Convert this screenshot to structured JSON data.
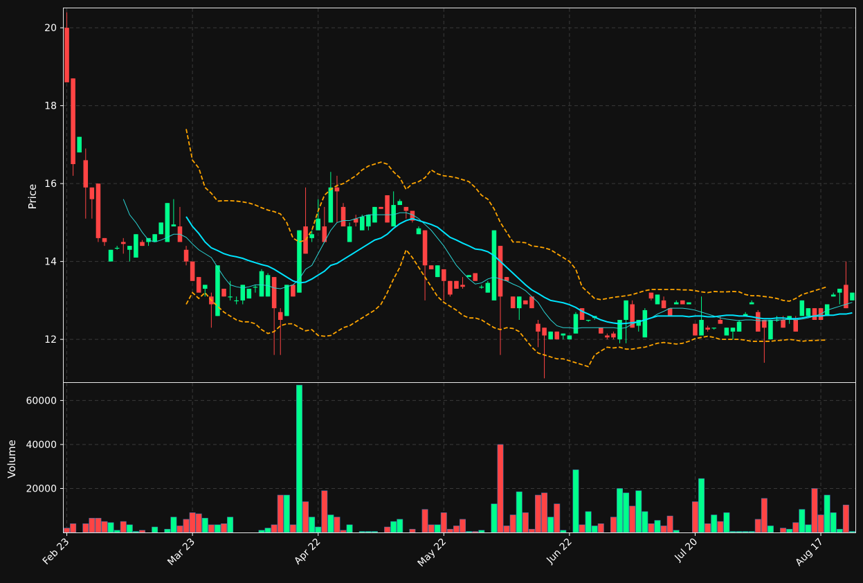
{
  "chart_data": {
    "type": "candlestick",
    "price_panel": {
      "ylabel": "Price",
      "ylim": [
        10.9,
        20.5
      ],
      "yticks": [
        12,
        14,
        16,
        18,
        20
      ],
      "grid": true
    },
    "volume_panel": {
      "ylabel": "Volume",
      "ylim": [
        0,
        68000
      ],
      "yticks": [
        20000,
        40000,
        60000
      ],
      "grid": true
    },
    "x_tick_labels": [
      {
        "label": "Feb 23",
        "index": 0
      },
      {
        "label": "Mar 23",
        "index": 20
      },
      {
        "label": "Apr 22",
        "index": 40
      },
      {
        "label": "May 22",
        "index": 60
      },
      {
        "label": "Jun 22",
        "index": 80
      },
      {
        "label": "Jul 20",
        "index": 100
      },
      {
        "label": "Aug 17",
        "index": 120
      }
    ],
    "colors": {
      "background": "#111111",
      "up": "#00ff8c",
      "down": "#ff4444",
      "volume_edge": "#3b6ea5",
      "ma_fast": "#2ad4d4",
      "ma_slow": "#00e5ff",
      "bands": "#ffa500"
    },
    "candles": [
      [
        20.0,
        20.4,
        18.6,
        18.6
      ],
      [
        18.7,
        18.7,
        16.2,
        16.5
      ],
      [
        16.8,
        17.2,
        16.8,
        17.2
      ],
      [
        16.6,
        16.9,
        15.1,
        15.9
      ],
      [
        15.9,
        15.9,
        15.1,
        15.6
      ],
      [
        16.0,
        16.0,
        14.5,
        14.6
      ],
      [
        14.6,
        14.6,
        14.4,
        14.5
      ],
      [
        14.0,
        14.3,
        14.0,
        14.3
      ],
      [
        14.35,
        14.4,
        14.3,
        14.35
      ],
      [
        14.5,
        14.6,
        14.2,
        14.45
      ],
      [
        14.3,
        14.4,
        14.0,
        14.4
      ],
      [
        14.1,
        14.7,
        14.1,
        14.7
      ],
      [
        14.5,
        14.55,
        14.4,
        14.4
      ],
      [
        14.5,
        14.6,
        14.4,
        14.6
      ],
      [
        14.5,
        14.7,
        14.5,
        14.7
      ],
      [
        14.7,
        15.0,
        14.7,
        15.0
      ],
      [
        14.5,
        15.5,
        14.5,
        15.5
      ],
      [
        14.9,
        15.6,
        14.9,
        14.95
      ],
      [
        14.9,
        15.4,
        14.5,
        14.5
      ],
      [
        14.3,
        14.4,
        13.9,
        14.0
      ],
      [
        14.0,
        14.0,
        13.5,
        13.5
      ],
      [
        13.6,
        13.6,
        13.2,
        13.2
      ],
      [
        13.3,
        13.4,
        13.1,
        13.4
      ],
      [
        13.1,
        13.2,
        12.3,
        12.9
      ],
      [
        12.6,
        13.9,
        12.6,
        13.9
      ],
      [
        13.3,
        13.3,
        13.1,
        13.1
      ],
      [
        13.1,
        13.5,
        13.0,
        13.1
      ],
      [
        13.0,
        13.1,
        12.9,
        13.0
      ],
      [
        13.0,
        13.4,
        12.9,
        13.4
      ],
      [
        13.05,
        13.3,
        13.05,
        13.3
      ],
      [
        13.35,
        13.4,
        13.2,
        13.35
      ],
      [
        13.1,
        13.8,
        13.1,
        13.75
      ],
      [
        13.1,
        13.7,
        13.1,
        13.65
      ],
      [
        13.6,
        13.6,
        11.6,
        12.8
      ],
      [
        12.7,
        12.8,
        11.6,
        12.5
      ],
      [
        12.6,
        13.4,
        12.6,
        13.4
      ],
      [
        13.4,
        13.4,
        13.1,
        13.1
      ],
      [
        13.2,
        14.8,
        13.2,
        14.8
      ],
      [
        14.9,
        15.9,
        14.2,
        14.2
      ],
      [
        14.6,
        14.8,
        14.5,
        14.7
      ],
      [
        14.8,
        15.6,
        14.8,
        15.1
      ],
      [
        14.9,
        15.4,
        14.5,
        14.5
      ],
      [
        15.0,
        16.3,
        15.0,
        15.9
      ],
      [
        15.9,
        16.2,
        15.0,
        15.8
      ],
      [
        15.4,
        15.5,
        14.9,
        14.9
      ],
      [
        14.5,
        15.0,
        14.5,
        14.9
      ],
      [
        15.1,
        15.2,
        14.9,
        15.0
      ],
      [
        14.8,
        15.2,
        14.8,
        15.15
      ],
      [
        14.9,
        15.2,
        14.8,
        15.2
      ],
      [
        15.0,
        15.4,
        15.0,
        15.4
      ],
      [
        15.4,
        15.4,
        15.35,
        15.35
      ],
      [
        15.7,
        15.7,
        15.0,
        15.0
      ],
      [
        14.9,
        15.8,
        14.9,
        15.45
      ],
      [
        15.45,
        15.6,
        15.45,
        15.55
      ],
      [
        15.4,
        15.4,
        15.1,
        15.3
      ],
      [
        15.3,
        15.3,
        15.0,
        15.05
      ],
      [
        14.7,
        14.9,
        14.7,
        14.85
      ],
      [
        14.8,
        14.8,
        13.0,
        13.9
      ],
      [
        13.9,
        13.9,
        13.8,
        13.8
      ],
      [
        13.6,
        13.9,
        13.6,
        13.9
      ],
      [
        13.8,
        13.8,
        13.0,
        13.5
      ],
      [
        13.5,
        13.5,
        13.1,
        13.15
      ],
      [
        13.5,
        13.5,
        13.3,
        13.3
      ],
      [
        13.4,
        13.6,
        13.3,
        13.35
      ],
      [
        13.6,
        13.65,
        13.6,
        13.65
      ],
      [
        13.7,
        13.7,
        13.5,
        13.5
      ],
      [
        13.35,
        13.4,
        13.3,
        13.35
      ],
      [
        13.2,
        13.5,
        13.2,
        13.45
      ],
      [
        13.0,
        14.8,
        13.0,
        14.8
      ],
      [
        14.4,
        14.4,
        11.6,
        13.1
      ],
      [
        13.6,
        13.6,
        13.5,
        13.5
      ],
      [
        13.1,
        13.1,
        12.8,
        12.8
      ],
      [
        12.8,
        13.1,
        12.5,
        13.1
      ],
      [
        13.0,
        13.0,
        12.9,
        12.9
      ],
      [
        13.1,
        13.1,
        12.8,
        12.8
      ],
      [
        12.4,
        12.5,
        11.8,
        12.2
      ],
      [
        12.3,
        12.3,
        11.0,
        12.1
      ],
      [
        12.0,
        12.2,
        12.0,
        12.2
      ],
      [
        12.2,
        12.2,
        12.0,
        12.0
      ],
      [
        12.1,
        12.15,
        12.0,
        12.15
      ],
      [
        12.0,
        12.1,
        12.0,
        12.1
      ],
      [
        12.15,
        12.7,
        12.15,
        12.65
      ],
      [
        12.8,
        12.8,
        12.5,
        12.5
      ],
      [
        12.5,
        12.5,
        12.45,
        12.5
      ],
      [
        12.55,
        12.6,
        12.5,
        12.6
      ],
      [
        12.3,
        12.3,
        12.15,
        12.15
      ],
      [
        12.1,
        12.15,
        12.0,
        12.05
      ],
      [
        12.15,
        12.2,
        12.0,
        12.05
      ],
      [
        12.0,
        12.5,
        11.9,
        12.5
      ],
      [
        12.5,
        13.0,
        11.9,
        13.0
      ],
      [
        12.9,
        13.0,
        12.3,
        12.3
      ],
      [
        12.35,
        12.5,
        12.2,
        12.5
      ],
      [
        12.05,
        12.8,
        12.05,
        12.75
      ],
      [
        13.2,
        13.2,
        13.0,
        13.05
      ],
      [
        12.9,
        13.15,
        12.9,
        13.15
      ],
      [
        13.0,
        13.1,
        12.8,
        12.8
      ],
      [
        12.8,
        12.8,
        12.6,
        12.6
      ],
      [
        12.9,
        13.0,
        12.9,
        12.95
      ],
      [
        13.0,
        13.0,
        12.9,
        12.9
      ],
      [
        12.9,
        12.95,
        12.9,
        12.95
      ],
      [
        12.4,
        12.4,
        12.1,
        12.1
      ],
      [
        12.1,
        13.1,
        12.1,
        12.5
      ],
      [
        12.3,
        12.35,
        12.2,
        12.25
      ],
      [
        12.3,
        12.3,
        12.25,
        12.3
      ],
      [
        12.5,
        12.6,
        12.4,
        12.4
      ],
      [
        12.1,
        12.3,
        12.1,
        12.3
      ],
      [
        12.2,
        12.3,
        12.0,
        12.3
      ],
      [
        12.2,
        12.5,
        12.2,
        12.45
      ],
      [
        12.6,
        12.7,
        12.6,
        12.65
      ],
      [
        12.9,
        13.0,
        12.95,
        12.95
      ],
      [
        12.7,
        12.75,
        12.2,
        12.2
      ],
      [
        12.5,
        12.5,
        11.4,
        12.3
      ],
      [
        12.0,
        12.5,
        12.0,
        12.5
      ],
      [
        12.5,
        12.6,
        12.45,
        12.5
      ],
      [
        12.5,
        12.6,
        12.3,
        12.3
      ],
      [
        12.5,
        12.6,
        12.4,
        12.6
      ],
      [
        12.5,
        12.6,
        12.2,
        12.2
      ],
      [
        12.6,
        13.0,
        12.6,
        13.0
      ],
      [
        12.6,
        12.8,
        12.6,
        12.8
      ],
      [
        12.8,
        12.8,
        12.5,
        12.5
      ],
      [
        12.8,
        12.8,
        12.5,
        12.5
      ],
      [
        12.6,
        12.9,
        12.6,
        12.9
      ],
      [
        13.1,
        13.2,
        13.1,
        13.15
      ],
      [
        13.2,
        13.3,
        12.9,
        13.3
      ],
      [
        13.4,
        14.0,
        12.8,
        12.8
      ],
      [
        13.0,
        13.2,
        13.0,
        13.2
      ]
    ],
    "volume": [
      2000,
      4000,
      0,
      4000,
      6500,
      6500,
      5000,
      4500,
      1000,
      5000,
      3500,
      500,
      1000,
      0,
      2500,
      0,
      1500,
      7000,
      3000,
      6000,
      9000,
      8500,
      6500,
      3500,
      3500,
      4000,
      7000,
      0,
      0,
      0,
      0,
      1000,
      2000,
      3500,
      17000,
      17000,
      3500,
      67000,
      14000,
      7000,
      2500,
      19000,
      8000,
      7000,
      1000,
      3500,
      0,
      500,
      500,
      500,
      0,
      2500,
      5000,
      6000,
      0,
      1500,
      0,
      10500,
      3500,
      3500,
      9000,
      1500,
      3000,
      6000,
      500,
      500,
      1000,
      0,
      13000,
      40000,
      3000,
      8000,
      18500,
      9000,
      1500,
      17000,
      18000,
      7000,
      13000,
      1000,
      0,
      28500,
      3500,
      9500,
      3000,
      4000,
      0,
      7000,
      20000,
      18000,
      12000,
      19000,
      9500,
      4000,
      5500,
      3000,
      7500,
      1000,
      0,
      0,
      14000,
      24500,
      4000,
      8000,
      5000,
      9000,
      500,
      500,
      500,
      500,
      6000,
      15500,
      3000,
      0,
      2000,
      1500,
      4500,
      10500,
      3500,
      20000,
      8000,
      17000,
      9000,
      1500,
      12500,
      500
    ],
    "ma_fast": [
      null,
      null,
      null,
      null,
      null,
      null,
      null,
      null,
      null,
      15.6,
      15.2,
      15.0,
      14.75,
      14.55,
      14.5,
      14.55,
      14.62,
      14.7,
      14.7,
      14.62,
      14.45,
      14.3,
      14.2,
      14.1,
      13.85,
      13.6,
      13.4,
      13.35,
      13.32,
      13.35,
      13.4,
      13.4,
      13.38,
      13.32,
      13.3,
      13.35,
      13.4,
      13.55,
      13.8,
      13.9,
      14.2,
      14.5,
      14.8,
      15.0,
      15.05,
      15.05,
      15.1,
      15.15,
      15.2,
      15.2,
      15.2,
      15.2,
      15.2,
      15.25,
      15.25,
      15.2,
      15.1,
      14.95,
      14.8,
      14.6,
      14.4,
      14.15,
      13.9,
      13.72,
      13.55,
      13.42,
      13.45,
      13.55,
      13.6,
      13.55,
      13.5,
      13.42,
      13.35,
      13.25,
      13.1,
      12.95,
      12.7,
      12.5,
      12.35,
      12.3,
      12.3,
      12.28,
      12.3,
      12.3,
      12.3,
      12.3,
      12.3,
      12.3,
      12.28,
      12.3,
      12.4,
      12.45,
      12.5,
      12.55,
      12.65,
      12.72,
      12.8,
      12.8,
      12.8,
      12.78,
      12.75,
      12.7,
      12.65,
      12.6,
      12.55,
      12.52,
      12.5,
      12.48,
      12.5,
      12.5,
      12.48,
      12.48,
      12.48,
      12.5,
      12.5,
      12.52,
      12.5,
      12.52,
      12.55,
      12.6,
      12.65,
      12.75,
      12.8,
      12.85,
      12.9,
      12.95
    ],
    "ma_slow": [
      null,
      null,
      null,
      null,
      null,
      null,
      null,
      null,
      null,
      null,
      null,
      null,
      null,
      null,
      null,
      null,
      null,
      null,
      null,
      15.15,
      14.9,
      14.72,
      14.5,
      14.35,
      14.28,
      14.2,
      14.15,
      14.12,
      14.08,
      14.02,
      13.97,
      13.92,
      13.88,
      13.8,
      13.7,
      13.6,
      13.5,
      13.45,
      13.47,
      13.55,
      13.65,
      13.75,
      13.9,
      13.95,
      14.05,
      14.15,
      14.25,
      14.35,
      14.45,
      14.55,
      14.6,
      14.7,
      14.85,
      14.97,
      15.05,
      15.1,
      15.05,
      15.0,
      14.95,
      14.88,
      14.75,
      14.62,
      14.55,
      14.47,
      14.4,
      14.32,
      14.3,
      14.25,
      14.15,
      14.0,
      13.85,
      13.7,
      13.55,
      13.4,
      13.27,
      13.18,
      13.08,
      13.0,
      12.97,
      12.94,
      12.89,
      12.82,
      12.72,
      12.65,
      12.57,
      12.5,
      12.45,
      12.42,
      12.4,
      12.41,
      12.43,
      12.45,
      12.5,
      12.55,
      12.6,
      12.6,
      12.6,
      12.6,
      12.6,
      12.58,
      12.6,
      12.6,
      12.58,
      12.58,
      12.6,
      12.62,
      12.62,
      12.6,
      12.6,
      12.58,
      12.55,
      12.53,
      12.53,
      12.55,
      12.55,
      12.53,
      12.53,
      12.55,
      12.58,
      12.6,
      12.6,
      12.62,
      12.62,
      12.65,
      12.65,
      12.68
    ],
    "band_upper": [
      null,
      null,
      null,
      null,
      null,
      null,
      null,
      null,
      null,
      null,
      null,
      null,
      null,
      null,
      null,
      null,
      null,
      null,
      null,
      17.4,
      16.6,
      16.4,
      15.9,
      15.75,
      15.55,
      15.56,
      15.56,
      15.55,
      15.53,
      15.5,
      15.45,
      15.38,
      15.32,
      15.28,
      15.22,
      15.0,
      14.6,
      14.5,
      14.55,
      14.8,
      15.3,
      15.7,
      15.85,
      15.95,
      16.0,
      16.1,
      16.2,
      16.35,
      16.45,
      16.5,
      16.55,
      16.5,
      16.3,
      16.15,
      15.85,
      16.0,
      16.05,
      16.15,
      16.35,
      16.25,
      16.2,
      16.18,
      16.15,
      16.1,
      16.05,
      15.9,
      15.7,
      15.6,
      15.35,
      15.0,
      14.75,
      14.5,
      14.5,
      14.48,
      14.4,
      14.38,
      14.35,
      14.3,
      14.2,
      14.1,
      14.0,
      13.8,
      13.35,
      13.2,
      13.05,
      13.02,
      13.05,
      13.08,
      13.1,
      13.12,
      13.15,
      13.2,
      13.25,
      13.28,
      13.28,
      13.28,
      13.28,
      13.28,
      13.27,
      13.27,
      13.25,
      13.22,
      13.2,
      13.23,
      13.22,
      13.22,
      13.23,
      13.22,
      13.15,
      13.12,
      13.12,
      13.1,
      13.08,
      13.05,
      13.0,
      12.98,
      13.05,
      13.15,
      13.2,
      13.25,
      13.3,
      13.35
    ],
    "band_lower": [
      null,
      null,
      null,
      null,
      null,
      null,
      null,
      null,
      null,
      null,
      null,
      null,
      null,
      null,
      null,
      null,
      null,
      null,
      null,
      12.9,
      13.2,
      13.05,
      13.2,
      13.0,
      12.85,
      12.7,
      12.6,
      12.5,
      12.45,
      12.45,
      12.4,
      12.25,
      12.15,
      12.2,
      12.35,
      12.4,
      12.4,
      12.3,
      12.22,
      12.25,
      12.1,
      12.08,
      12.1,
      12.2,
      12.3,
      12.35,
      12.45,
      12.55,
      12.65,
      12.75,
      12.9,
      13.2,
      13.55,
      13.85,
      14.3,
      14.1,
      13.85,
      13.6,
      13.35,
      13.1,
      12.95,
      12.85,
      12.75,
      12.62,
      12.55,
      12.55,
      12.5,
      12.4,
      12.3,
      12.25,
      12.3,
      12.28,
      12.2,
      12.0,
      11.8,
      11.65,
      11.6,
      11.55,
      11.5,
      11.5,
      11.45,
      11.4,
      11.35,
      11.3,
      11.6,
      11.7,
      11.8,
      11.78,
      11.8,
      11.75,
      11.75,
      11.78,
      11.8,
      11.85,
      11.9,
      11.92,
      11.9,
      11.88,
      11.9,
      11.95,
      12.02,
      12.05,
      12.08,
      12.05,
      12.0,
      12.0,
      12.0,
      12.0,
      11.98,
      11.95,
      11.95,
      11.95,
      11.95,
      11.97,
      11.98,
      12.0,
      11.98,
      11.95,
      11.97,
      11.97,
      11.98,
      11.98
    ]
  }
}
